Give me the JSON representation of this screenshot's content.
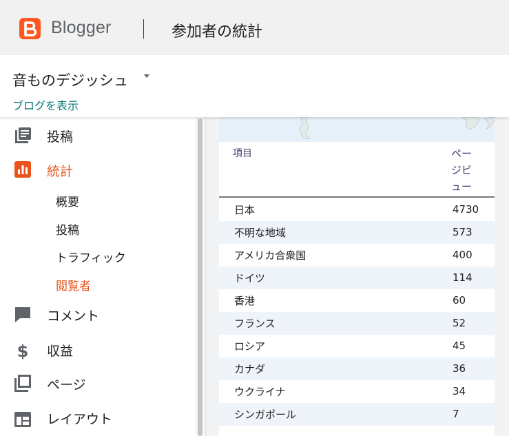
{
  "app": {
    "brand": "Blogger",
    "page_title": "参加者の統計"
  },
  "blog": {
    "name": "音ものデジッシュ",
    "view_link": "ブログを表示"
  },
  "sidebar": {
    "items": [
      {
        "label": "投稿",
        "icon": "posts-icon"
      },
      {
        "label": "統計",
        "icon": "stats-icon",
        "active": true
      },
      {
        "label": "コメント",
        "icon": "comment-icon"
      },
      {
        "label": "収益",
        "icon": "dollar-icon"
      },
      {
        "label": "ページ",
        "icon": "pages-icon"
      },
      {
        "label": "レイアウト",
        "icon": "layout-icon"
      }
    ],
    "sub_items": [
      {
        "label": "概要"
      },
      {
        "label": "投稿"
      },
      {
        "label": "トラフィック"
      },
      {
        "label": "閲覧者",
        "active": true
      }
    ]
  },
  "table": {
    "headers": {
      "item": "項目",
      "views_lines": [
        "ペー",
        "ジビ",
        "ュー"
      ]
    },
    "rows": [
      {
        "country": "日本",
        "views": "4730"
      },
      {
        "country": "不明な地域",
        "views": "573"
      },
      {
        "country": "アメリカ合衆国",
        "views": "400"
      },
      {
        "country": "ドイツ",
        "views": "114"
      },
      {
        "country": "香港",
        "views": "60"
      },
      {
        "country": "フランス",
        "views": "52"
      },
      {
        "country": "ロシア",
        "views": "45"
      },
      {
        "country": "カナダ",
        "views": "36"
      },
      {
        "country": "ウクライナ",
        "views": "34"
      },
      {
        "country": "シンガポール",
        "views": "7"
      }
    ]
  },
  "colors": {
    "accent": "#e8541c",
    "brand": "#ff5722",
    "link": "#0b7b79"
  }
}
